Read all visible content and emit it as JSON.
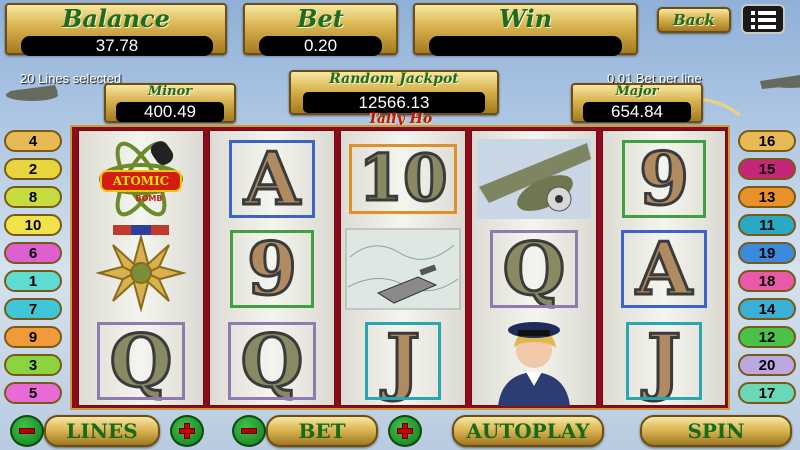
{
  "header": {
    "balance_label": "Balance",
    "balance_value": "37.78",
    "bet_label": "Bet",
    "bet_value": "0.20",
    "win_label": "Win",
    "win_value": "",
    "back_label": "Back",
    "menu_icon": "menu-icon"
  },
  "info": {
    "lines_selected": "20 Lines selected",
    "bet_per_line": "0.01 Bet per line"
  },
  "jackpots": {
    "minor_label": "Minor",
    "minor_value": "400.49",
    "random_label": "Random Jackpot",
    "random_value": "12566.13",
    "major_label": "Major",
    "major_value": "654.84"
  },
  "game_title": "Tally Ho",
  "reels": [
    [
      "Atomic Bomb",
      "medal",
      "Q"
    ],
    [
      "A",
      "9",
      "Q"
    ],
    [
      "10",
      "map",
      "J"
    ],
    [
      "plane",
      "Q",
      "pilot"
    ],
    [
      "9",
      "A",
      "J"
    ]
  ],
  "symbols": {
    "atomic_text_1": "ATOMIC",
    "atomic_text_2": "BOMB"
  },
  "left_lines": [
    "4",
    "2",
    "8",
    "10",
    "6",
    "1",
    "7",
    "9",
    "3",
    "5"
  ],
  "right_lines": [
    "16",
    "15",
    "13",
    "11",
    "19",
    "18",
    "14",
    "12",
    "20",
    "17"
  ],
  "controls": {
    "lines_label": "LINES",
    "bet_label": "BET",
    "autoplay_label": "AUTOPLAY",
    "spin_label": "SPIN"
  },
  "colors": {
    "gold": "#d9b24f",
    "green_text": "#1f6b22",
    "reel_border": "#8c0a1a"
  }
}
